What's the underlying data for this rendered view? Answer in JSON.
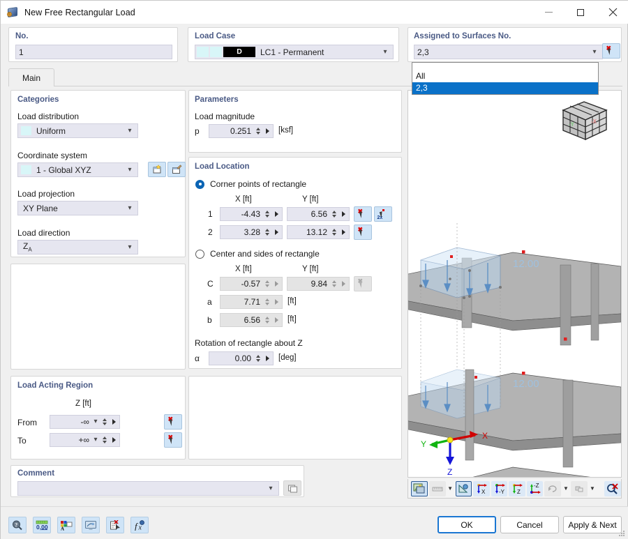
{
  "window": {
    "title": "New Free Rectangular Load",
    "icon": "load-cube-icon",
    "minimize": "minimize-icon",
    "maximize": "maximize-icon",
    "close": "close-icon"
  },
  "top": {
    "no_label": "No.",
    "no_value": "1",
    "load_case_label": "Load Case",
    "load_case_badge": "D",
    "load_case_value": "LC1 - Permanent",
    "assigned_label": "Assigned to Surfaces No.",
    "assigned_value": "2,3",
    "dropdown_options": [
      "All",
      "2,3"
    ],
    "dropdown_selected": "2,3"
  },
  "tabs": [
    {
      "label": "Main",
      "active": true
    }
  ],
  "categories": {
    "title": "Categories",
    "load_distribution_label": "Load distribution",
    "load_distribution_value": "Uniform",
    "coordinate_system_label": "Coordinate system",
    "coordinate_system_value": "1 - Global XYZ",
    "load_projection_label": "Load projection",
    "load_projection_value": "XY Plane",
    "load_direction_label": "Load direction",
    "load_direction_value": "Z",
    "load_direction_sub": "A"
  },
  "parameters": {
    "title": "Parameters",
    "magnitude_label": "Load magnitude",
    "p_symbol": "p",
    "p_value": "0.251",
    "p_unit": "[ksf]"
  },
  "load_location": {
    "title": "Load Location",
    "mode_corner_label": "Corner points of rectangle",
    "mode_center_label": "Center and sides of rectangle",
    "mode_selected": "corner",
    "col_x": "X [ft]",
    "col_y": "Y [ft]",
    "corner_rows": [
      {
        "name": "1",
        "x": "-4.43",
        "y": "6.56"
      },
      {
        "name": "2",
        "x": "3.28",
        "y": "13.12"
      }
    ],
    "center_rows": [
      {
        "name": "C",
        "x": "-0.57",
        "y": "9.84"
      }
    ],
    "side_a_label": "a",
    "side_a_value": "7.71",
    "side_a_unit": "[ft]",
    "side_b_label": "b",
    "side_b_value": "6.56",
    "side_b_unit": "[ft]",
    "rotation_label": "Rotation of rectangle about Z",
    "rotation_symbol": "α",
    "rotation_value": "0.00",
    "rotation_unit": "[deg]"
  },
  "load_acting_region": {
    "title": "Load Acting Region",
    "col_z": "Z [ft]",
    "from_label": "From",
    "from_value": "-∞",
    "to_label": "To",
    "to_value": "+∞"
  },
  "comment": {
    "title": "Comment",
    "value": "",
    "copy_button": "comment-copy-button"
  },
  "viewport": {
    "axis_x": "X",
    "axis_y": "Y",
    "axis_z": "Z",
    "nav_cube_face_left": "-Y",
    "nav_cube_face_right": "-X",
    "dimension_labels": [
      "12.00",
      "12.00"
    ],
    "toolbar_buttons": [
      "render-mode-button",
      "ruler-dropdown-button",
      "measure-button",
      "view-x-button",
      "view-minus-y-button",
      "view-z-button",
      "view-minus-z-button",
      "rotate-dropdown-button",
      "pan-dropdown-button",
      "deselect-zoom-button"
    ]
  },
  "bottom": {
    "tool_buttons": [
      "help-search-icon",
      "units-icon",
      "font-display-icon",
      "display-properties-icon",
      "comment-pick-icon",
      "formula-icon"
    ],
    "ok_label": "OK",
    "cancel_label": "Cancel",
    "apply_next_label": "Apply & Next"
  },
  "colors": {
    "accent_blue": "#0a71c8",
    "group_title": "#4a5a85",
    "field_bg": "#e6e6f0",
    "button_blue": "#cfe4f7"
  }
}
